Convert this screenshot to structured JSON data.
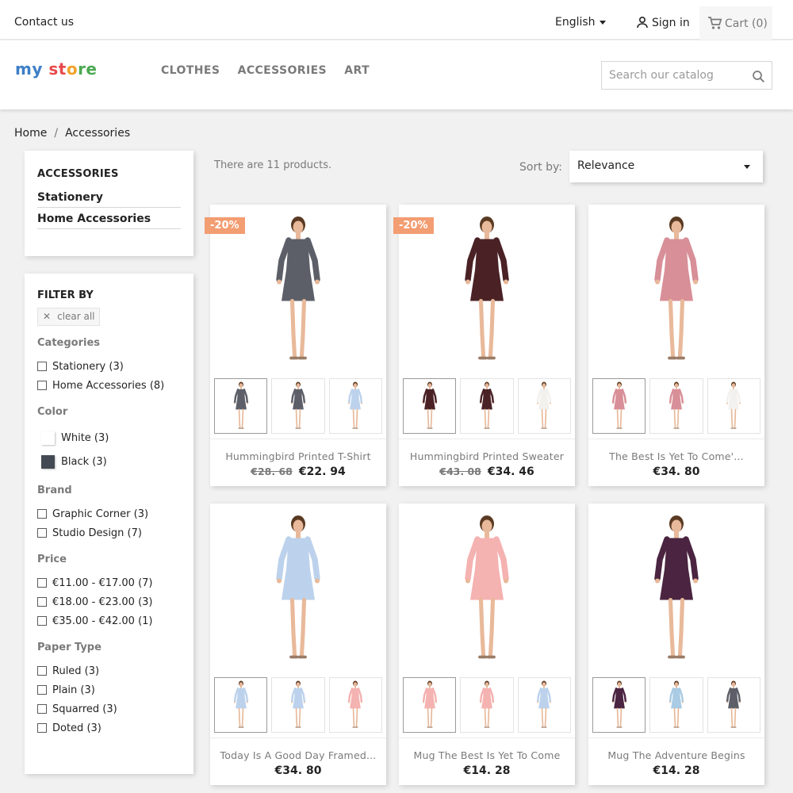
{
  "topbar": {
    "contact": "Contact us",
    "language": "English",
    "signin": "Sign in",
    "cart": "Cart (0)"
  },
  "header": {
    "logo": [
      "my ",
      "st",
      "o",
      "re"
    ],
    "nav": [
      "CLOTHES",
      "ACCESSORIES",
      "ART"
    ],
    "search_placeholder": "Search our catalog"
  },
  "breadcrumb": [
    "Home",
    "Accessories"
  ],
  "categories": {
    "title": "ACCESSORIES",
    "items": [
      "Stationery",
      "Home Accessories"
    ]
  },
  "filters": {
    "title": "FILTER BY",
    "clear_all": "clear all",
    "facets": [
      {
        "name": "Categories",
        "options": [
          "Stationery (3)",
          "Home Accessories (8)"
        ]
      },
      {
        "name": "Color",
        "options": [
          "White (3)",
          "Black (3)"
        ],
        "colors": [
          "#ffffff",
          "#434a54"
        ]
      },
      {
        "name": "Brand",
        "options": [
          "Graphic Corner (3)",
          "Studio Design (7)"
        ]
      },
      {
        "name": "Price",
        "options": [
          "€11.00 - €17.00 (7)",
          "€18.00 - €23.00 (3)",
          "€35.00 - €42.00 (1)"
        ]
      },
      {
        "name": "Paper Type",
        "options": [
          "Ruled (3)",
          "Plain (3)",
          "Squarred (3)",
          "Doted (3)"
        ]
      }
    ]
  },
  "listing": {
    "count_text": "There are 11 products.",
    "sort_label": "Sort by:",
    "sort_value": "Relevance"
  },
  "products": [
    {
      "title": "Hummingbird Printed T-Shirt",
      "old_price": "€28. 68",
      "price": "€22. 94",
      "badge": "-20%",
      "dress": "geo",
      "thumbs": [
        "geo",
        "geo",
        "lightblue"
      ]
    },
    {
      "title": "Hummingbird Printed Sweater",
      "old_price": "€43. 08",
      "price": "€34. 46",
      "badge": "-20%",
      "dress": "maroon",
      "thumbs": [
        "maroon",
        "maroon",
        "white"
      ]
    },
    {
      "title": "The Best Is Yet To Come'...",
      "old_price": "",
      "price": "€34. 80",
      "badge": "",
      "dress": "floral",
      "thumbs": [
        "floral",
        "floral",
        "white"
      ]
    },
    {
      "title": "Today Is A Good Day Framed...",
      "old_price": "",
      "price": "€34. 80",
      "badge": "",
      "dress": "lightblue",
      "thumbs": [
        "lightblue",
        "lightblue",
        "pink"
      ]
    },
    {
      "title": "Mug The Best Is Yet To Come",
      "old_price": "",
      "price": "€14. 28",
      "badge": "",
      "dress": "pink",
      "thumbs": [
        "pink",
        "pink",
        "lightblue"
      ]
    },
    {
      "title": "Mug The Adventure Begins",
      "old_price": "",
      "price": "€14. 28",
      "badge": "",
      "dress": "navyfloral",
      "thumbs": [
        "navyfloral",
        "skyblue",
        "geo"
      ]
    }
  ],
  "dress_colors": {
    "geo": "#5c5f68",
    "maroon": "#4a2226",
    "floral": "#d88f98",
    "lightblue": "#bcd2ec",
    "pink": "#f4b2b0",
    "navyfloral": "#4a2440",
    "skyblue": "#a9cbe4",
    "white": "#f3f1ee"
  },
  "colors": {
    "text": "#232323",
    "muted": "#7a7a7a",
    "badge": "#f39d72",
    "background": "#f1f1f1"
  }
}
